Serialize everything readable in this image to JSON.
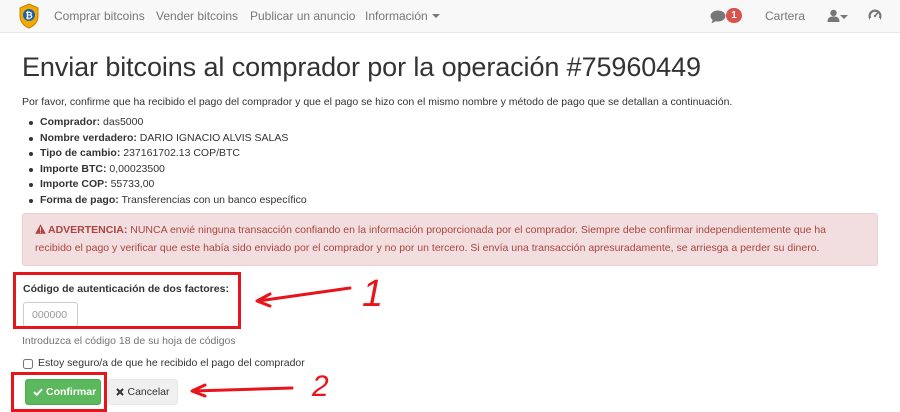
{
  "nav": {
    "items": [
      "Comprar bitcoins",
      "Vender bitcoins",
      "Publicar un anuncio",
      "Información"
    ],
    "notification_count": "1",
    "wallet_label": "Cartera"
  },
  "main": {
    "title": "Enviar bitcoins al comprador por la operación #75960449",
    "intro": "Por favor, confirme que ha recibido el pago del comprador y que el pago se hizo con el mismo nombre y método de pago que se detallan a continuación.",
    "details": [
      {
        "label": "Comprador:",
        "value": "das5000"
      },
      {
        "label": "Nombre verdadero:",
        "value": "DARIO IGNACIO ALVIS SALAS"
      },
      {
        "label": "Tipo de cambio:",
        "value": "237161702.13 COP/BTC"
      },
      {
        "label": "Importe BTC:",
        "value": "0,00023500"
      },
      {
        "label": "Importe COP:",
        "value": "55733,00"
      },
      {
        "label": "Forma de pago:",
        "value": "Transferencias con un banco específico"
      }
    ],
    "warning": {
      "label": "ADVERTENCIA:",
      "line1": "NUNCA envié ninguna transacción confiando en la información proporcionada por el comprador. Siempre debe confirmar independientemente que ha",
      "line2": "recibido el pago y verificar que este había sido enviado por el comprador y no por un tercero. Si envía una transacción apresuradamente, se arriesga a perder su dinero."
    },
    "twofa": {
      "label": "Código de autenticación de dos factores:",
      "placeholder": "000000",
      "value": "",
      "help": "Introduzca el código 18 de su hoja de códigos"
    },
    "checkbox_label": "Estoy seguro/a de que he recibido el pago del comprador",
    "confirm_label": "Confirmar",
    "cancel_label": "Cancelar"
  },
  "annotations": {
    "mark_1": "1",
    "mark_2": "2",
    "color": "#e8141b"
  }
}
